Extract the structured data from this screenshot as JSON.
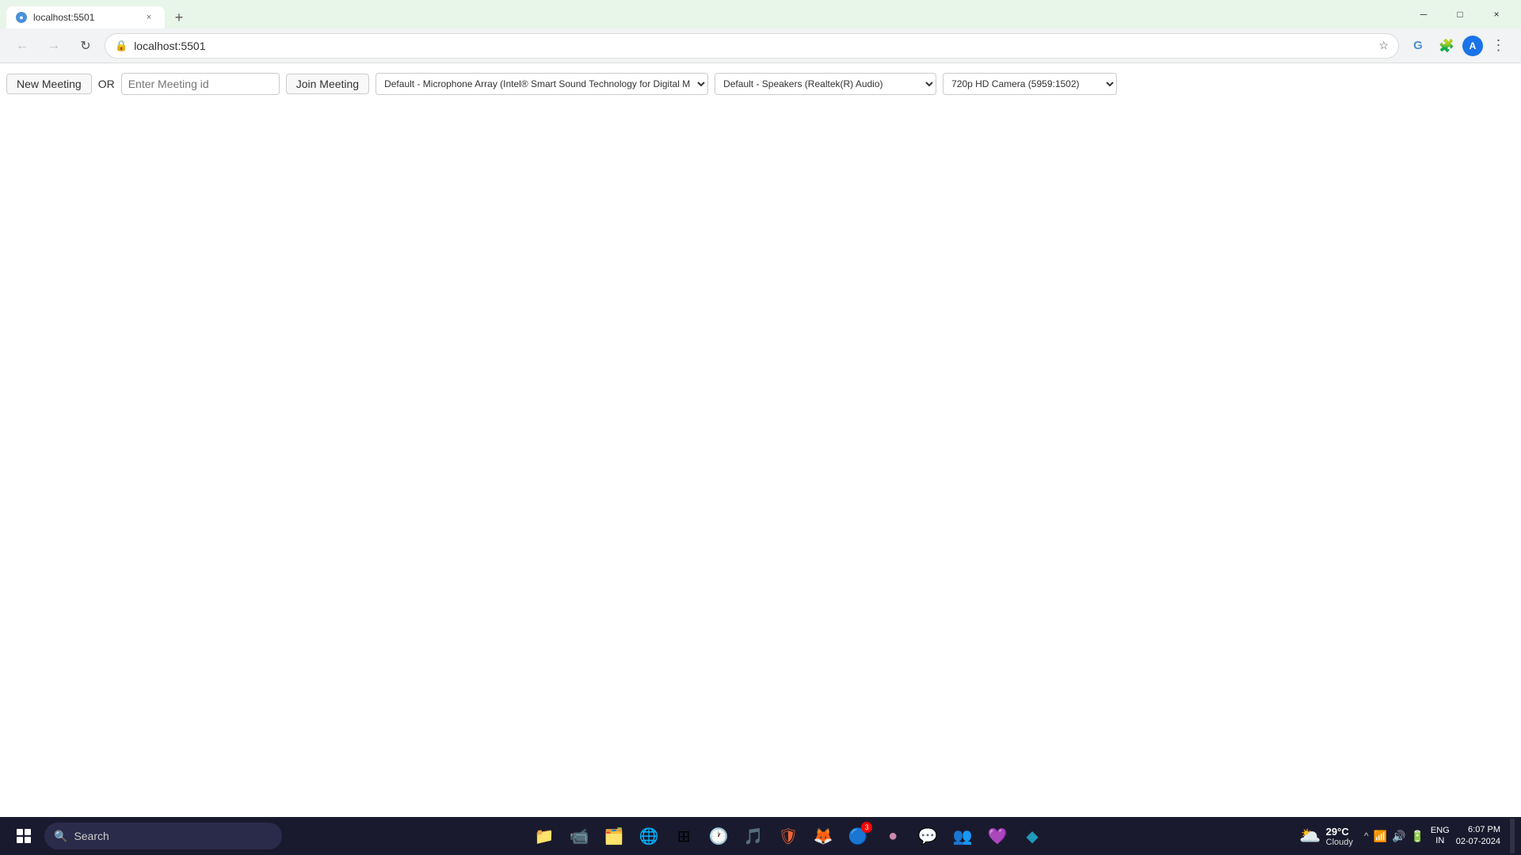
{
  "browser": {
    "tab": {
      "favicon": "🌐",
      "title": "localhost:5501",
      "close_icon": "×"
    },
    "new_tab_icon": "+",
    "window_controls": {
      "minimize": "─",
      "maximize": "□",
      "close": "×"
    },
    "nav": {
      "back_icon": "←",
      "forward_icon": "→",
      "reload_icon": "↻",
      "url": "localhost:5501",
      "star_icon": "☆",
      "google_translate_icon": "T",
      "extensions_icon": "🧩",
      "profile_letter": "A",
      "more_icon": "⋮"
    }
  },
  "app": {
    "new_meeting_label": "New Meeting",
    "or_label": "OR",
    "meeting_id_placeholder": "Enter Meeting id",
    "join_meeting_label": "Join Meeting",
    "microphone_options": [
      "Default - Microphone Array (Intel® Smart Sound Technology for Digital Microphones)"
    ],
    "microphone_selected": "Default - Microphone Array (Intel® Smart Sound Technology for Digital Microphones)",
    "speaker_options": [
      "Default - Speakers (Realtek(R) Audio)"
    ],
    "speaker_selected": "Default - Speakers (Realtek(R) Audio)",
    "camera_options": [
      "720p HD Camera (5959:1502)"
    ],
    "camera_selected": "720p HD Camera (5959:1502)"
  },
  "taskbar": {
    "search_placeholder": "Search",
    "apps": [
      {
        "name": "files",
        "icon": "📁",
        "badge": null
      },
      {
        "name": "meet",
        "icon": "📹",
        "badge": null
      },
      {
        "name": "folder-yellow",
        "icon": "🗂️",
        "badge": null
      },
      {
        "name": "edge",
        "icon": "🌐",
        "badge": null
      },
      {
        "name": "apps-grid",
        "icon": "⊞",
        "badge": null
      },
      {
        "name": "clock-app",
        "icon": "🕐",
        "badge": null
      },
      {
        "name": "spotify",
        "icon": "🎵",
        "badge": null
      },
      {
        "name": "red-app",
        "icon": "🛡️",
        "badge": null
      },
      {
        "name": "firefox",
        "icon": "🦊",
        "badge": null
      },
      {
        "name": "chrome",
        "icon": "🔵",
        "badge": "3"
      },
      {
        "name": "chrome-ext",
        "icon": "🟤",
        "badge": null
      },
      {
        "name": "discord",
        "icon": "💬",
        "badge": null
      },
      {
        "name": "teams",
        "icon": "👥",
        "badge": null
      },
      {
        "name": "purple-app",
        "icon": "💜",
        "badge": null
      },
      {
        "name": "vscode",
        "icon": "🔷",
        "badge": null
      }
    ],
    "tray": {
      "chevron": "^",
      "wifi": "📶",
      "speaker": "🔊",
      "battery": "🔋",
      "brightness": "☀"
    },
    "language": "ENG\nIN",
    "clock": "6:07 PM\n02-07-2024",
    "weather": {
      "icon": "🌥️",
      "temp": "29°C",
      "desc": "Cloudy"
    }
  }
}
